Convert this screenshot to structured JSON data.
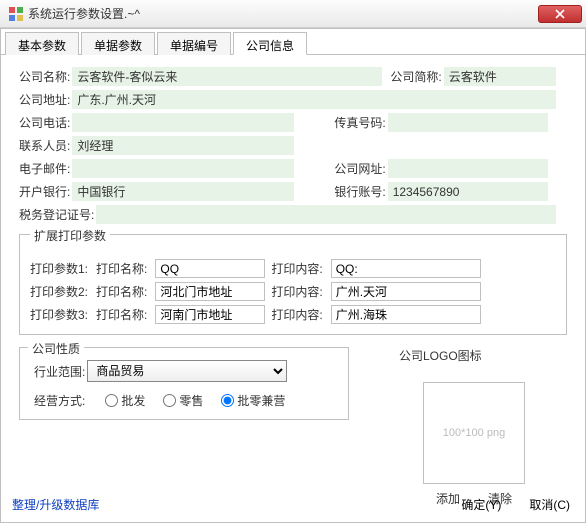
{
  "window": {
    "title": "系统运行参数设置.~^"
  },
  "tabs": [
    {
      "label": "基本参数"
    },
    {
      "label": "单据参数"
    },
    {
      "label": "单据编号"
    },
    {
      "label": "公司信息"
    }
  ],
  "labels": {
    "company_name": "公司名称:",
    "company_short": "公司简称:",
    "company_addr": "公司地址:",
    "company_tel": "公司电话:",
    "fax": "传真号码:",
    "contact": "联系人员:",
    "email": "电子邮件:",
    "website": "公司网址:",
    "bank": "开户银行:",
    "bank_acct": "银行账号:",
    "tax_reg": "税务登记证号:",
    "ext_print": "扩展打印参数",
    "print_param1": "打印参数1:",
    "print_param2": "打印参数2:",
    "print_param3": "打印参数3:",
    "print_name": "打印名称:",
    "print_content": "打印内容:",
    "company_nature": "公司性质",
    "industry": "行业范围:",
    "mgmt": "经营方式:",
    "logo_title": "公司LOGO图标",
    "logo_hint": "100*100 png",
    "add": "添加",
    "clear": "清除",
    "db_link": "整理/升级数据库",
    "ok": "确定(Y)",
    "cancel": "取消(C)"
  },
  "values": {
    "company_name": "云客软件-客似云来",
    "company_short": "云客软件",
    "company_addr": "广东.广州.天河",
    "company_tel": "",
    "fax": "",
    "contact": "刘经理",
    "email": "",
    "website": "",
    "bank": "中国银行",
    "bank_acct": "1234567890",
    "tax_reg": "",
    "industry": "商品贸易"
  },
  "print": [
    {
      "name": "QQ",
      "content": "QQ:"
    },
    {
      "name": "河北门市地址",
      "content": "广州.天河"
    },
    {
      "name": "河南门市地址",
      "content": "广州.海珠"
    }
  ],
  "mgmt_options": {
    "wholesale": "批发",
    "retail": "零售",
    "both": "批零兼营"
  }
}
